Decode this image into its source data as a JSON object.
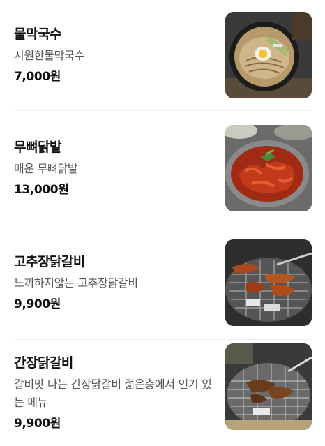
{
  "menu": {
    "items": [
      {
        "name": "물막국수",
        "description": "시원한물막국수",
        "price": "7,000원",
        "image_icon": "cold-buckwheat-noodle-photo"
      },
      {
        "name": "무뼈닭발",
        "description": "매운 무뼈닭발",
        "price": "13,000원",
        "image_icon": "spicy-chicken-feet-photo"
      },
      {
        "name": "고추장닭갈비",
        "description": "느끼하지않는 고추장닭갈비",
        "price": "9,900원",
        "image_icon": "gochujang-grilled-chicken-photo"
      },
      {
        "name": "간장닭갈비",
        "description": "갈비맛 나는 간장닭갈비 젊은층에서 인기 있는 메뉴",
        "price": "9,900원",
        "image_icon": "soy-grilled-chicken-photo"
      }
    ]
  },
  "colors": {
    "text_primary": "#111111",
    "text_secondary": "#555555",
    "divider": "#eeeeee"
  }
}
